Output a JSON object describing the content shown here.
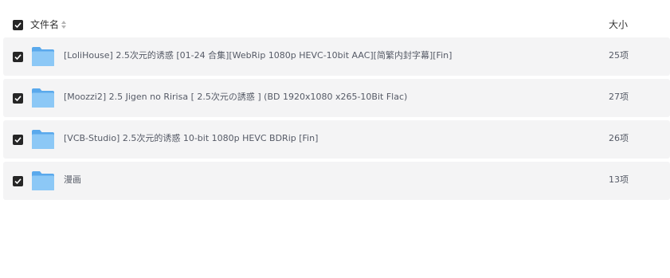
{
  "header": {
    "name_label": "文件名",
    "size_label": "大小"
  },
  "rows": [
    {
      "name": "[LoliHouse] 2.5次元的诱惑 [01-24 合集][WebRip 1080p HEVC-10bit AAC][简繁内封字幕][Fin]",
      "size": "25项"
    },
    {
      "name": "[Moozzi2] 2.5 Jigen no Ririsa [ 2.5次元の誘惑 ] (BD 1920x1080 x265-10Bit Flac)",
      "size": "27项"
    },
    {
      "name": "[VCB-Studio] 2.5次元的诱惑 10-bit 1080p HEVC BDRip [Fin]",
      "size": "26项"
    },
    {
      "name": "漫画",
      "size": "13项"
    }
  ],
  "icons": {
    "checkbox": "checkbox-checked-icon",
    "folder": "folder-icon",
    "sort": "sort-icon"
  },
  "colors": {
    "row_background": "#f4f4f5",
    "checkbox": "#262626",
    "folder_back": "#5aa9ec",
    "folder_front": "#8cc8f6"
  }
}
